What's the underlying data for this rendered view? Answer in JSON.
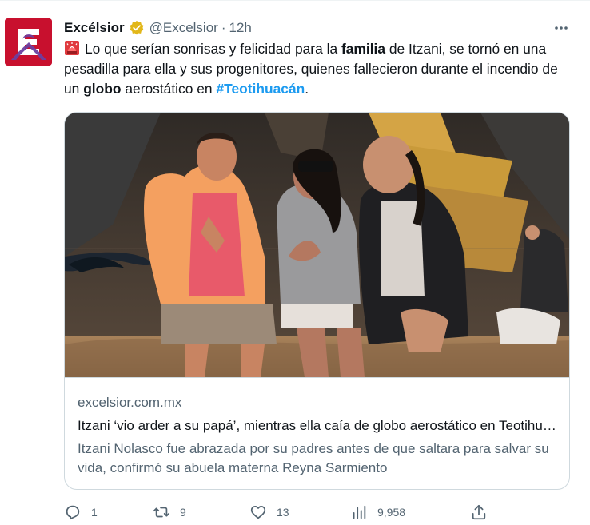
{
  "tweet": {
    "author_name": "Excélsior",
    "handle": "@Excelsior",
    "separator": "·",
    "time": "12h",
    "text": {
      "p1": "Lo que serían sonrisas y felicidad para la ",
      "b1": "familia",
      "p2": " de Itzani, se tornó en una pesadilla para ella y sus progenitores, quienes fallecieron durante el incendio de un ",
      "b2": "globo",
      "p3": " aerostático en ",
      "hashtag": "#Teotihuacán",
      "p4": "."
    }
  },
  "card": {
    "domain": "excelsior.com.mx",
    "title": "Itzani ‘vio arder a su papá’, mientras ella caía de globo aerostático en Teotihuacán",
    "description": "Itzani Nolasco fue abrazada por su padres antes de que saltara para salvar su vida, confirmó su abuela materna Reyna Sarmiento"
  },
  "actions": {
    "replies": "1",
    "reposts": "9",
    "likes": "13",
    "views": "9,958"
  },
  "icons": {
    "avatar": "excelsior-logo",
    "verified": "verified-badge-icon",
    "more": "more-icon",
    "siren": "siren-emoji-icon",
    "reply": "reply-icon",
    "repost": "repost-icon",
    "like": "heart-icon",
    "views": "views-icon",
    "share": "share-icon"
  },
  "colors": {
    "brand": "#c8102e",
    "link": "#1d9bf0",
    "muted": "#536471",
    "verified": "#e2b719"
  }
}
